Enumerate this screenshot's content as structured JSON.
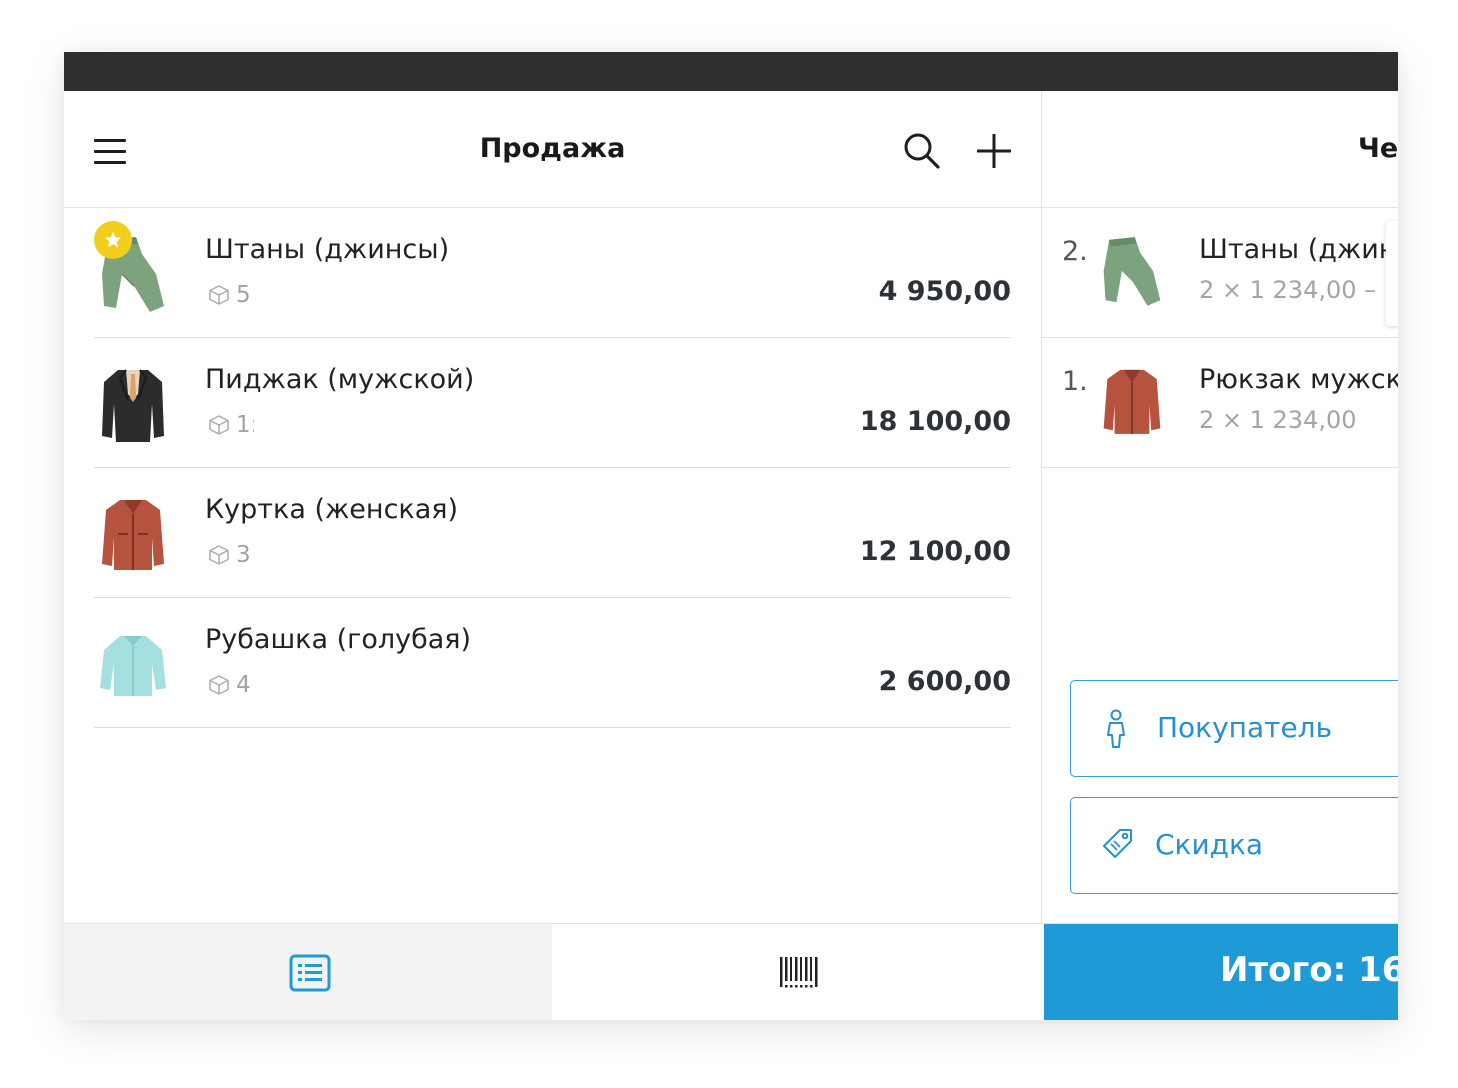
{
  "sale_screen": {
    "title": "Продажа",
    "products": [
      {
        "name": "Штаны (джинсы)",
        "stock": "5",
        "price": "4 950,00",
        "favorite": true,
        "image": "green-pants"
      },
      {
        "name": "Пиджак (мужской)",
        "stock": "1:",
        "price": "18 100,00",
        "favorite": false,
        "image": "black-blazer"
      },
      {
        "name": "Куртка (женская)",
        "stock": "3",
        "price": "12 100,00",
        "favorite": false,
        "image": "leather-jacket"
      },
      {
        "name": "Рубашка (голубая)",
        "stock": "4",
        "price": "2 600,00",
        "favorite": false,
        "image": "blue-shirt"
      }
    ]
  },
  "receipt": {
    "title": "Че",
    "items": [
      {
        "index": "2.",
        "name": "Штаны (джин",
        "qty": "2 × 1 234,00 – ",
        "image": "green-pants"
      },
      {
        "index": "1.",
        "name": "Рюкзак мужск",
        "qty": "2 × 1 234,00",
        "image": "leather-jacket"
      }
    ],
    "buyer_label": "Покупатель",
    "discount_label": "Скидка"
  },
  "bottom": {
    "total_label": "Итого: 16"
  },
  "colors": {
    "accent": "#1e9bd7",
    "favorite": "#f2cf1d",
    "status_bar": "#2f2f2f"
  }
}
